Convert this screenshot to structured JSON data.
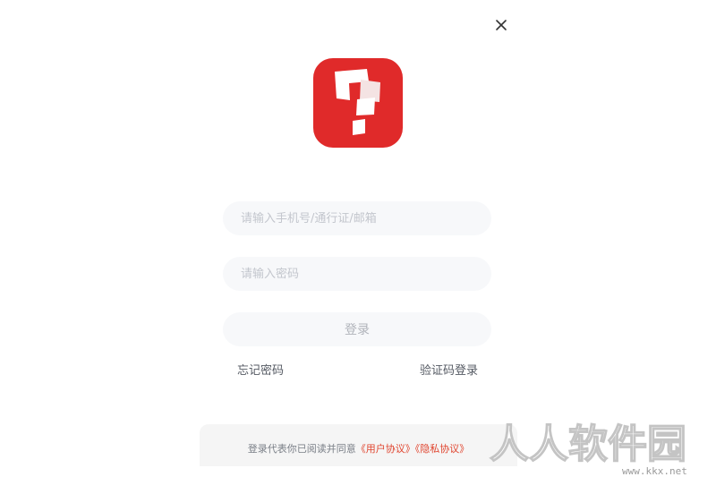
{
  "window": {
    "close_icon": "close-icon"
  },
  "logo": {
    "icon": "question-block-logo-icon",
    "color": "#e02a2a"
  },
  "form": {
    "account_placeholder": "请输入手机号/通行证/邮箱",
    "password_placeholder": "请输入密码",
    "login_label": "登录"
  },
  "links": {
    "forgot_password": "忘记密码",
    "sms_login": "验证码登录"
  },
  "footer": {
    "prefix": "登录代表你已阅读并同意",
    "user_agreement": "《用户协议》",
    "privacy_agreement": "《隐私协议》",
    "accent_color": "#e0452f"
  },
  "watermark": {
    "text": "人人软件园",
    "url": "www.kkx.net"
  }
}
